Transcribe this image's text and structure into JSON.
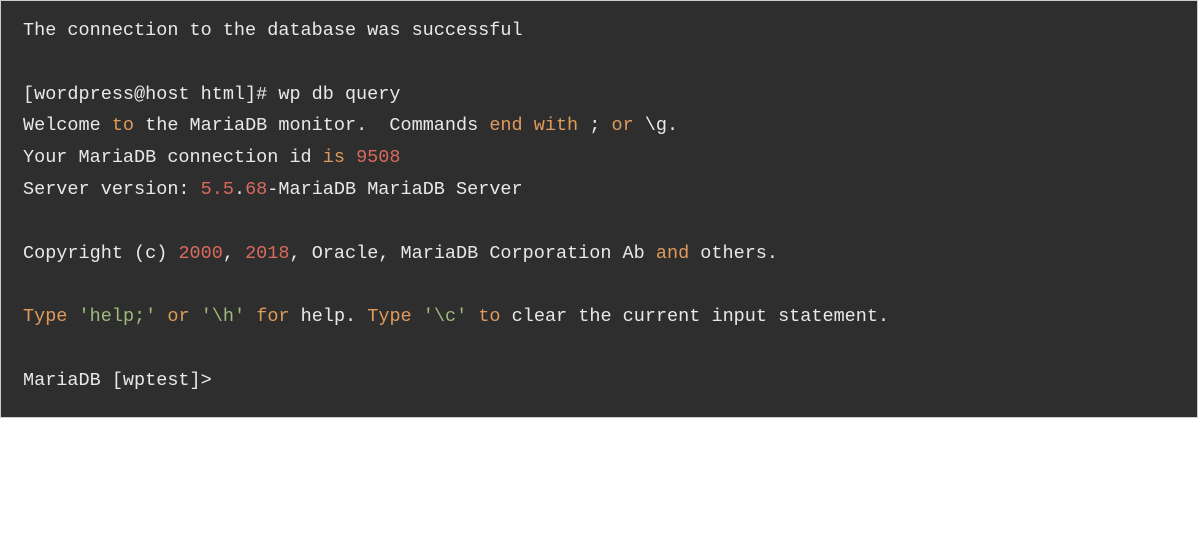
{
  "terminal": {
    "line1": "The connection to the database was successful",
    "blank": "",
    "prompt1": "[wordpress@host html]# wp db query",
    "welcome_pre": "Welcome ",
    "welcome_to": "to",
    "welcome_mid": " the MariaDB monitor.  Commands ",
    "welcome_end": "end",
    "welcome_sp": " ",
    "welcome_with": "with",
    "welcome_semi": " ; ",
    "welcome_or": "or",
    "welcome_g": " \\g.",
    "conn_pre": "Your MariaDB connection id ",
    "conn_is": "is",
    "conn_sp": " ",
    "conn_id": "9508",
    "ver_pre": "Server version: ",
    "ver_major": "5.5",
    "ver_dot": ".",
    "ver_patch": "68",
    "ver_post": "-MariaDB MariaDB Server",
    "copy_pre": "Copyright (c) ",
    "copy_y1": "2000",
    "copy_comma": ", ",
    "copy_y2": "2018",
    "copy_mid": ", Oracle, MariaDB Corporation Ab ",
    "copy_and": "and",
    "copy_post": " others.",
    "h_type1": "Type",
    "h_sp1": " ",
    "h_help": "'help;'",
    "h_sp2": " ",
    "h_or": "or",
    "h_sp3": " ",
    "h_h": "'\\h'",
    "h_sp4": " ",
    "h_for": "for",
    "h_mid": " help. ",
    "h_type2": "Type",
    "h_sp5": " ",
    "h_c": "'\\c'",
    "h_sp6": " ",
    "h_to": "to",
    "h_post": " clear the current input statement.",
    "prompt2": "MariaDB [wptest]>"
  }
}
